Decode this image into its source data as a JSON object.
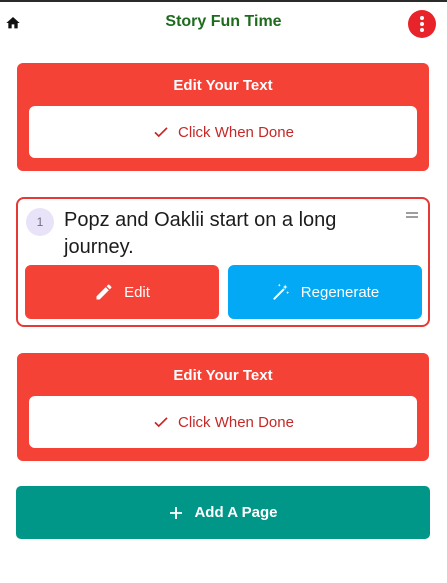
{
  "app_bar": {
    "title": "Story Fun Time",
    "home_icon": "home-icon",
    "menu_icon": "more-vert-icon"
  },
  "edit_panels": [
    {
      "title": "Edit Your Text",
      "done_label": "Click When Done"
    },
    {
      "title": "Edit Your Text",
      "done_label": "Click When Done"
    }
  ],
  "page_card": {
    "number": "1",
    "text": "Popz and Oaklii start on a long journey.",
    "edit_label": "Edit",
    "regenerate_label": "Regenerate"
  },
  "add_page": {
    "label": "Add A Page"
  },
  "colors": {
    "title_green": "#1e6b1e",
    "panel_red": "#f44336",
    "done_text_red": "#c62828",
    "regenerate_blue": "#03a9f4",
    "add_teal": "#009688",
    "menu_red": "#e8242a"
  }
}
